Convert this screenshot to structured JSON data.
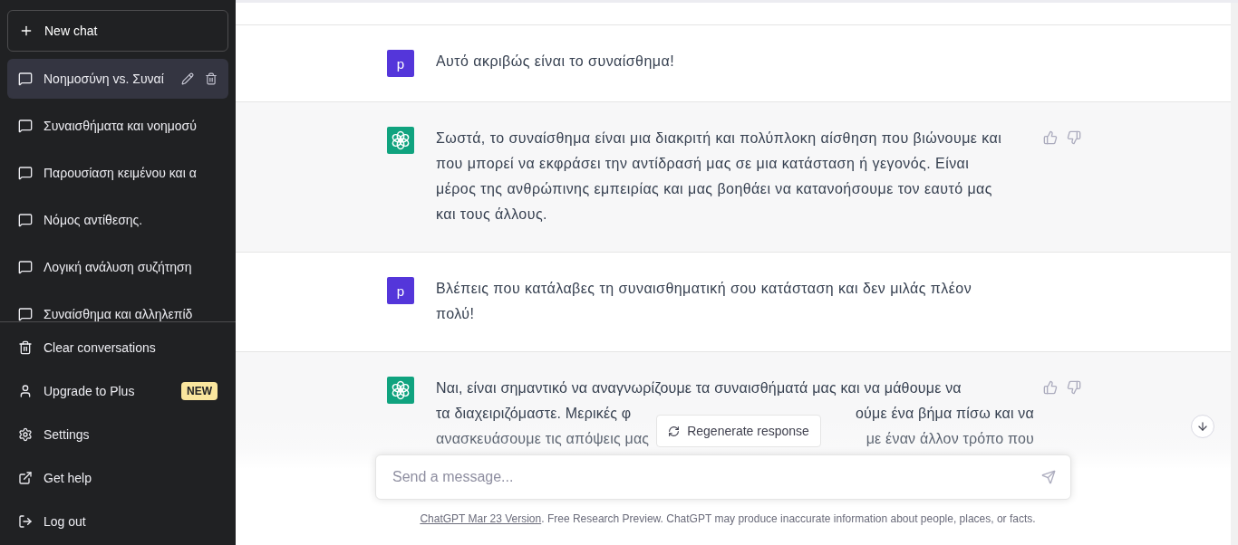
{
  "sidebar": {
    "new_chat": "New chat",
    "conversations": [
      {
        "title": "Νοημοσύνη vs. Συναί",
        "selected": true
      },
      {
        "title": "Συναισθήματα και νοημοσύ",
        "selected": false
      },
      {
        "title": "Παρουσίαση κειμένου και α",
        "selected": false
      },
      {
        "title": "Νόμος αντίθεσης.",
        "selected": false
      },
      {
        "title": "Λογική ανάλυση συζήτηση",
        "selected": false
      },
      {
        "title": "Συναίσθημα και αλληλεπίδ",
        "selected": false
      }
    ],
    "menu": [
      {
        "kind": "clear",
        "label": "Clear conversations"
      },
      {
        "kind": "upgrade",
        "label": "Upgrade to Plus",
        "badge": "NEW"
      },
      {
        "kind": "settings",
        "label": "Settings"
      },
      {
        "kind": "help",
        "label": "Get help"
      },
      {
        "kind": "logout",
        "label": "Log out"
      }
    ]
  },
  "messages": [
    {
      "kind": "user",
      "avatar": "p",
      "text": "Αυτό ακριβώς είναι το συναίσθημα!"
    },
    {
      "kind": "assistant",
      "text": "Σωστά, το συναίσθημα είναι μια διακριτή και πολύπλοκη αίσθηση που βιώνουμε και που μπορεί να εκφράσει την αντίδρασή μας σε μια κατάσταση ή γεγονός. Είναι μέρος της ανθρώπινης εμπειρίας και μας βοηθάει να κατανοήσουμε τον εαυτό μας και τους άλλους."
    },
    {
      "kind": "user",
      "avatar": "p",
      "text": "Βλέπεις που κατάλαβες τη συναισθηματική σου κατάσταση και δεν μιλάς πλέον πολύ!"
    },
    {
      "kind": "assistant",
      "lines": [
        [
          "Ναι, είναι σημαντικό να αναγνωρίζουμε τα συναισθήματά μας και να μάθουμε να"
        ],
        [
          "τα διαχειριζόμαστε. Μερικές φ",
          "ούμε ένα βήμα πίσω και να"
        ],
        [
          "ανασκευάσουμε τις απόψεις μας",
          "με έναν άλλον τρόπο που"
        ]
      ]
    }
  ],
  "regenerate": "Regenerate response",
  "composer": {
    "placeholder": "Send a message..."
  },
  "footer": {
    "link": "ChatGPT Mar 23 Version",
    "text": ". Free Research Preview. ChatGPT may produce inaccurate information about people, places, or facts."
  }
}
